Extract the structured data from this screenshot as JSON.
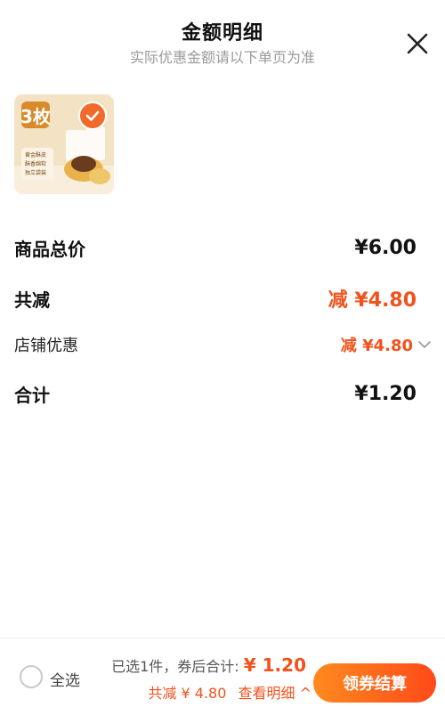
{
  "header": {
    "title": "金额明细",
    "subtitle": "实际优惠金额请以下单页为准"
  },
  "product": {
    "badge_text": "3枚",
    "features": [
      "黄金酥皮",
      "酥香绵软",
      "独立袋装"
    ]
  },
  "breakdown": {
    "total_label": "商品总价",
    "total_value": "¥6.00",
    "reduce_label": "共减",
    "reduce_value": "减 ¥4.80",
    "shop_discount_label": "店铺优惠",
    "shop_discount_value": "减 ¥4.80",
    "sum_label": "合计",
    "sum_value": "¥1.20"
  },
  "bottom_bar": {
    "select_all_label": "全选",
    "selected_text": "已选1件，券后合计:",
    "after_coupon_amount": "¥ 1.20",
    "total_reduce_text": "共减 ¥ 4.80",
    "view_detail_text": "查看明细 ^",
    "checkout_label": "领券结算"
  },
  "colors": {
    "accent": "#f0531c",
    "check": "#f26a2a"
  }
}
